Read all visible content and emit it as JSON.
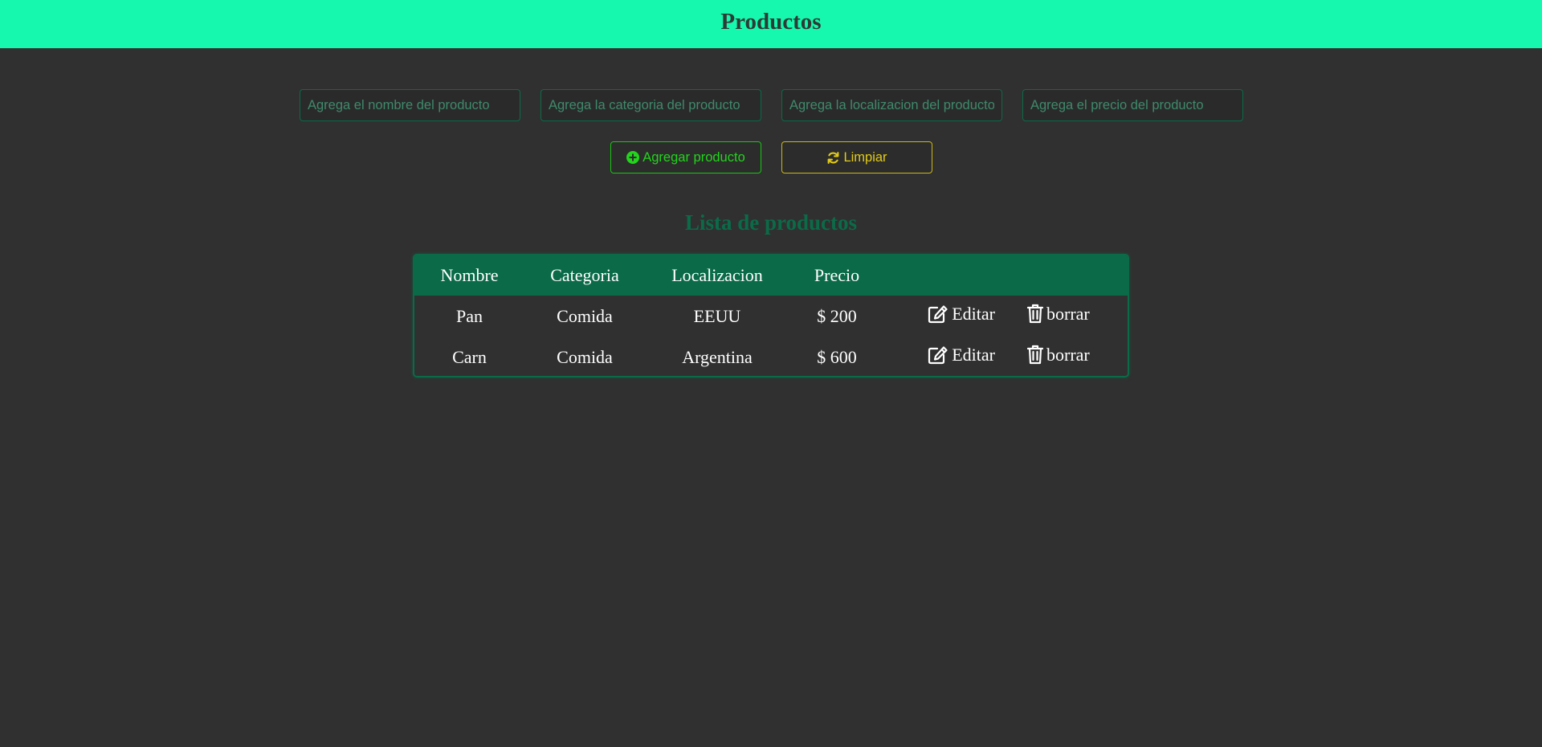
{
  "header": {
    "title": "Productos"
  },
  "form": {
    "name_placeholder": "Agrega el nombre del producto",
    "category_placeholder": "Agrega la categoria del producto",
    "location_placeholder": "Agrega la localizacion del producto",
    "price_placeholder": "Agrega el precio del producto"
  },
  "buttons": {
    "add_label": "Agregar producto",
    "add_icon": "plus-circle-icon",
    "clear_label": "Limpiar",
    "clear_icon": "refresh-icon"
  },
  "list": {
    "title": "Lista de productos",
    "columns": [
      "Nombre",
      "Categoria",
      "Localizacion",
      "Precio"
    ],
    "edit_label": "Editar",
    "delete_label": "borrar",
    "rows": [
      {
        "nombre": "Pan",
        "categoria": "Comida",
        "localizacion": "EEUU",
        "precio": "$ 200"
      },
      {
        "nombre": "Carn",
        "categoria": "Comida",
        "localizacion": "Argentina",
        "precio": "$ 600"
      }
    ]
  },
  "colors": {
    "header_bg": "#15f8ae",
    "page_bg": "#303030",
    "accent": "#0b6b49",
    "add_button": "#22d41c",
    "clear_button": "#e2cb16"
  }
}
